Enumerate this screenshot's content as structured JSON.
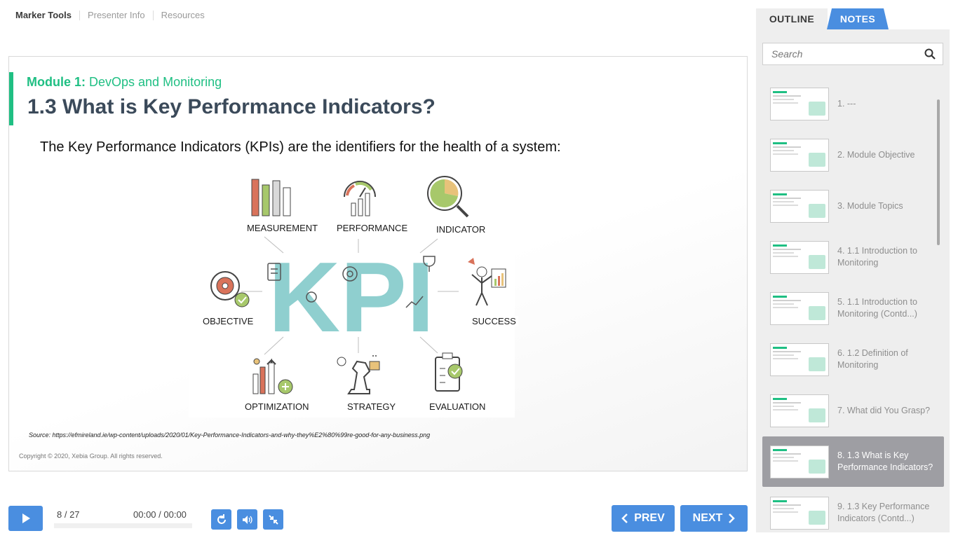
{
  "top_tabs": [
    "Marker Tools",
    "Presenter Info",
    "Resources"
  ],
  "slide": {
    "module_prefix": "Module 1:",
    "module_name": "DevOps and Monitoring",
    "title": "1.3 What is Key Performance Indicators?",
    "text": "The Key Performance Indicators (KPIs) are the identifiers for the health of a system:",
    "kpi_center": "KPI",
    "kpi_labels": {
      "measurement": "MEASUREMENT",
      "performance": "PERFORMANCE",
      "indicator": "INDICATOR",
      "objective": "OBJECTIVE",
      "success": "SUCCESS",
      "optimization": "OPTIMIZATION",
      "strategy": "STRATEGY",
      "evaluation": "EVALUATION"
    },
    "source": "Source: https://efmireland.ie/wp-content/uploads/2020/01/Key-Performance-Indicators-and-why-they%E2%80%99re-good-for-any-business.png",
    "copyright": "Copyright © 2020, Xebia Group. All rights reserved."
  },
  "controls": {
    "counter": "8 / 27",
    "time": "00:00 / 00:00",
    "progress": 0,
    "prev_label": "PREV",
    "next_label": "NEXT"
  },
  "panel": {
    "tab_outline": "OUTLINE",
    "tab_notes": "NOTES",
    "search_placeholder": "Search",
    "items": [
      {
        "label": "1. ---"
      },
      {
        "label": "2. Module Objective"
      },
      {
        "label": "3. Module Topics"
      },
      {
        "label": "4. 1.1 Introduction to Monitoring"
      },
      {
        "label": "5. 1.1 Introduction to Monitoring (Contd...)"
      },
      {
        "label": "6. 1.2 Definition of Monitoring"
      },
      {
        "label": "7. What did You Grasp?"
      },
      {
        "label": "8. 1.3 What is Key Performance Indicators?",
        "active": true
      },
      {
        "label": "9. 1.3 Key Performance Indicators (Contd...)"
      }
    ]
  },
  "colors": {
    "accent": "#4a8ee0",
    "module_green": "#1fbf83",
    "kpi_teal": "#8fcfcf",
    "title": "#3b4a5a"
  }
}
